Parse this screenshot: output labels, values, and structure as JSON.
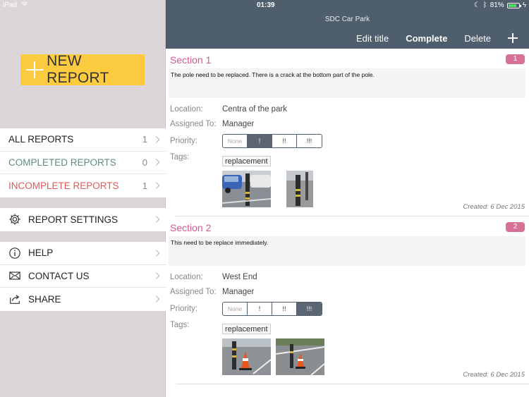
{
  "status": {
    "device": "iPad",
    "time": "01:39",
    "battery": "81%",
    "battery_level": 0.81
  },
  "sidebar": {
    "new_report_label": "NEW REPORT",
    "report_lists": [
      {
        "label": "ALL REPORTS",
        "count": "1"
      },
      {
        "label": "COMPLETED REPORTS",
        "count": "0"
      },
      {
        "label": "INCOMPLETE REPORTS",
        "count": "1"
      }
    ],
    "settings_label": "REPORT SETTINGS",
    "help_label": "HELP",
    "contact_label": "CONTACT US",
    "share_label": "SHARE"
  },
  "header": {
    "title": "SDC Car Park",
    "edit_title": "Edit title",
    "complete": "Complete",
    "delete": "Delete"
  },
  "labels": {
    "location": "Location:",
    "assigned": "Assigned To:",
    "priority": "Priority:",
    "tags": "Tags:"
  },
  "priority_options": [
    "None",
    "!",
    "!!",
    "!!!"
  ],
  "sections": [
    {
      "title": "Section 1",
      "number": "1",
      "description": "The pole need to be replaced. There is a crack at the bottom part of the pole.",
      "location": "Centra of the park",
      "assigned_to": "Manager",
      "priority_selected": "!",
      "tag": "replacement",
      "created": "Created: 6 Dec 2015"
    },
    {
      "title": "Section 2",
      "number": "2",
      "description": "This need to be replace immediately.",
      "location": "West End",
      "assigned_to": "Manager",
      "priority_selected": "!!!",
      "tag": "replacement",
      "created": "Created: 6 Dec 2015"
    }
  ],
  "colors": {
    "navbar": "#4f5e6c",
    "accent_yellow": "#fdcb3f",
    "section_pink": "#d05a8c",
    "completed_green": "#5b8f78",
    "incomplete_red": "#e05a5a"
  }
}
